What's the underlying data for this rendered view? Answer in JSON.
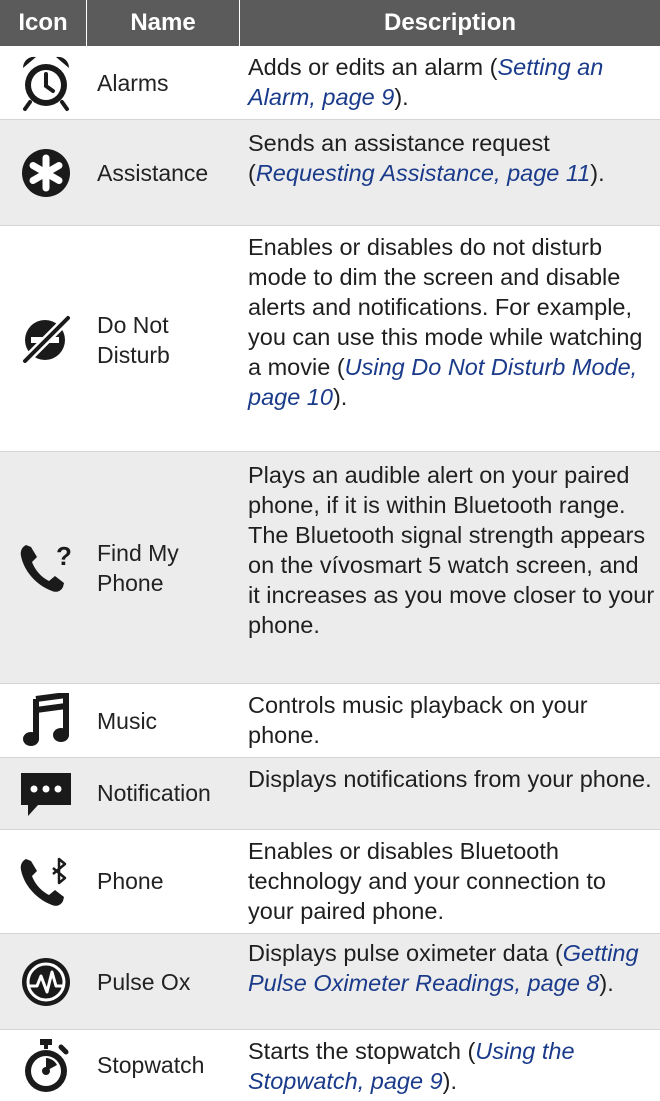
{
  "header": {
    "icon": "Icon",
    "name": "Name",
    "description": "Description"
  },
  "rows": [
    {
      "icon": "alarm-clock-icon",
      "name": "Alarms",
      "desc_pre": "Adds or edits an alarm (",
      "ref": "Setting an Alarm, page 9",
      "desc_post": ")."
    },
    {
      "icon": "assistance-asterisk-icon",
      "name": "Assistance",
      "desc_pre": "Sends an assistance request (",
      "ref": "Requesting Assistance, page 11",
      "desc_post": ")."
    },
    {
      "icon": "do-not-disturb-icon",
      "name": "Do Not Disturb",
      "desc_pre": "Enables or disables do not disturb mode to dim the screen and disable alerts and notifications. For example, you can use this mode while watching a movie (",
      "ref": "Using Do Not Disturb Mode, page 10",
      "desc_post": ")."
    },
    {
      "icon": "find-phone-icon",
      "name": "Find My Phone",
      "desc_pre": "Plays an audible alert on your paired phone, if it is within Bluetooth range. The Bluetooth signal strength appears on the vívosmart 5 watch screen, and it increases as you move closer to your phone.",
      "ref": "",
      "desc_post": ""
    },
    {
      "icon": "music-note-icon",
      "name": "Music",
      "desc_pre": "Controls music playback on your phone.",
      "ref": "",
      "desc_post": ""
    },
    {
      "icon": "notification-bubble-icon",
      "name": "Notification",
      "desc_pre": "Displays notifications from your phone.",
      "ref": "",
      "desc_post": ""
    },
    {
      "icon": "bluetooth-phone-icon",
      "name": "Phone",
      "desc_pre": "Enables or disables Bluetooth technology and your connection to your paired phone.",
      "ref": "",
      "desc_post": ""
    },
    {
      "icon": "pulse-ox-icon",
      "name": "Pulse Ox",
      "desc_pre": "Displays pulse oximeter data (",
      "ref": "Getting Pulse Oximeter Readings, page 8",
      "desc_post": ")."
    },
    {
      "icon": "stopwatch-icon",
      "name": "Stopwatch",
      "desc_pre": "Starts the stopwatch (",
      "ref": "Using the Stopwatch, page 9",
      "desc_post": ")."
    }
  ],
  "colors": {
    "header_bg": "#5b5b5b",
    "alt_row_bg": "#ececec",
    "link": "#1a3a8a"
  }
}
